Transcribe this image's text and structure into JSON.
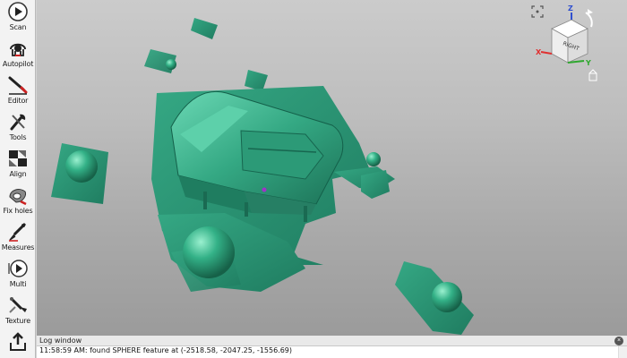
{
  "toolbar": {
    "items": [
      {
        "label": "Scan",
        "icon": "scan-icon"
      },
      {
        "label": "Autopilot",
        "icon": "autopilot-icon"
      },
      {
        "label": "Editor",
        "icon": "editor-icon"
      },
      {
        "label": "Tools",
        "icon": "tools-icon"
      },
      {
        "label": "Align",
        "icon": "align-icon"
      },
      {
        "label": "Fix holes",
        "icon": "fix-holes-icon"
      },
      {
        "label": "Measures",
        "icon": "measures-icon"
      },
      {
        "label": "Multi",
        "icon": "multi-icon"
      },
      {
        "label": "Texture",
        "icon": "texture-icon"
      },
      {
        "label": "",
        "icon": "export-icon"
      }
    ]
  },
  "navcube": {
    "face_label": "RIGHT",
    "axis_x": "X",
    "axis_y": "Y",
    "axis_z": "Z"
  },
  "log": {
    "title": "Log window",
    "lines": [
      "11:58:59 AM: found SPHERE feature at (-2518.58, -2047.25, -1556.69)"
    ]
  },
  "colors": {
    "mesh": "#2e9e7e",
    "mesh_dark": "#1f7a5f",
    "mesh_light": "#5fd3ad",
    "axis_x": "#e03030",
    "axis_y": "#2fa82f",
    "axis_z": "#2f4fcf"
  }
}
